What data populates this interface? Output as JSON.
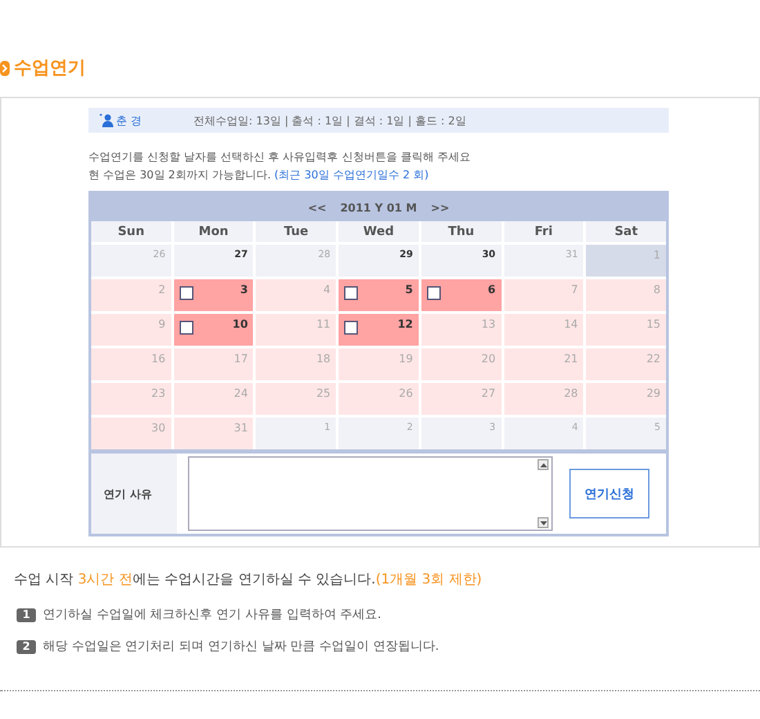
{
  "title": "수업연기",
  "info": {
    "name": "춘 경",
    "summary": "전체수업일: 13일 | 출석 : 1일 | 결석 : 1일 | 홀드 : 2일"
  },
  "instructions": [
    "수업연기를 신청할 날자를 선택하신 후 사유입력후 신청버튼을 클릭해 주세요"
  ],
  "limit_text": "현 수업은 30일 2회까지 가능합니다.",
  "limit_note": "(최근 30일 수업연기일수 2 회)",
  "calendar": {
    "prev": "<<",
    "month": "2011 Y 01 M",
    "next": ">>",
    "weekdays": [
      "Sun",
      "Mon",
      "Tue",
      "Wed",
      "Thu",
      "Fri",
      "Sat"
    ],
    "weeks": [
      [
        {
          "day": "26",
          "kind": "other"
        },
        {
          "day": "27",
          "kind": "other_class"
        },
        {
          "day": "28",
          "kind": "other"
        },
        {
          "day": "29",
          "kind": "other_class"
        },
        {
          "day": "30",
          "kind": "other_class"
        },
        {
          "day": "31",
          "kind": "other"
        },
        {
          "day": "1",
          "kind": "today"
        }
      ],
      [
        {
          "day": "2",
          "kind": "day"
        },
        {
          "day": "3",
          "kind": "class",
          "checked": false
        },
        {
          "day": "4",
          "kind": "day"
        },
        {
          "day": "5",
          "kind": "class",
          "checked": false
        },
        {
          "day": "6",
          "kind": "class",
          "checked": false
        },
        {
          "day": "7",
          "kind": "day"
        },
        {
          "day": "8",
          "kind": "day"
        }
      ],
      [
        {
          "day": "9",
          "kind": "day"
        },
        {
          "day": "10",
          "kind": "class",
          "checked": false
        },
        {
          "day": "11",
          "kind": "day"
        },
        {
          "day": "12",
          "kind": "class",
          "checked": false
        },
        {
          "day": "13",
          "kind": "day"
        },
        {
          "day": "14",
          "kind": "day"
        },
        {
          "day": "15",
          "kind": "day"
        }
      ],
      [
        {
          "day": "16",
          "kind": "day"
        },
        {
          "day": "17",
          "kind": "day"
        },
        {
          "day": "18",
          "kind": "day"
        },
        {
          "day": "19",
          "kind": "day"
        },
        {
          "day": "20",
          "kind": "day"
        },
        {
          "day": "21",
          "kind": "day"
        },
        {
          "day": "22",
          "kind": "day"
        }
      ],
      [
        {
          "day": "23",
          "kind": "day"
        },
        {
          "day": "24",
          "kind": "day"
        },
        {
          "day": "25",
          "kind": "day"
        },
        {
          "day": "26",
          "kind": "day"
        },
        {
          "day": "27",
          "kind": "day"
        },
        {
          "day": "28",
          "kind": "day"
        },
        {
          "day": "29",
          "kind": "day"
        }
      ],
      [
        {
          "day": "30",
          "kind": "day"
        },
        {
          "day": "31",
          "kind": "day"
        },
        {
          "day": "1",
          "kind": "other"
        },
        {
          "day": "2",
          "kind": "other"
        },
        {
          "day": "3",
          "kind": "other"
        },
        {
          "day": "4",
          "kind": "other"
        },
        {
          "day": "5",
          "kind": "other"
        }
      ]
    ]
  },
  "reason_label": "연기 사유",
  "submit_button": "연기신청",
  "notice": [
    {
      "text": "수업 시작 ",
      "highlight": false
    },
    {
      "text": "3시간 전",
      "highlight": true
    },
    {
      "text": "에는 수업시간을 연기하실 수 있습니다.",
      "highlight": false
    },
    {
      "text": "(1개월 3회 제한)",
      "highlight": true
    }
  ],
  "steps": [
    {
      "number": "1",
      "text": "연기하실 수업일에 체크하신후 연기 사유를 입력하여 주세요."
    },
    {
      "number": "2",
      "text": "해당 수업일은 연기처리 되며 연기하신 날짜 만큼 수업일이 연장됩니다."
    }
  ]
}
